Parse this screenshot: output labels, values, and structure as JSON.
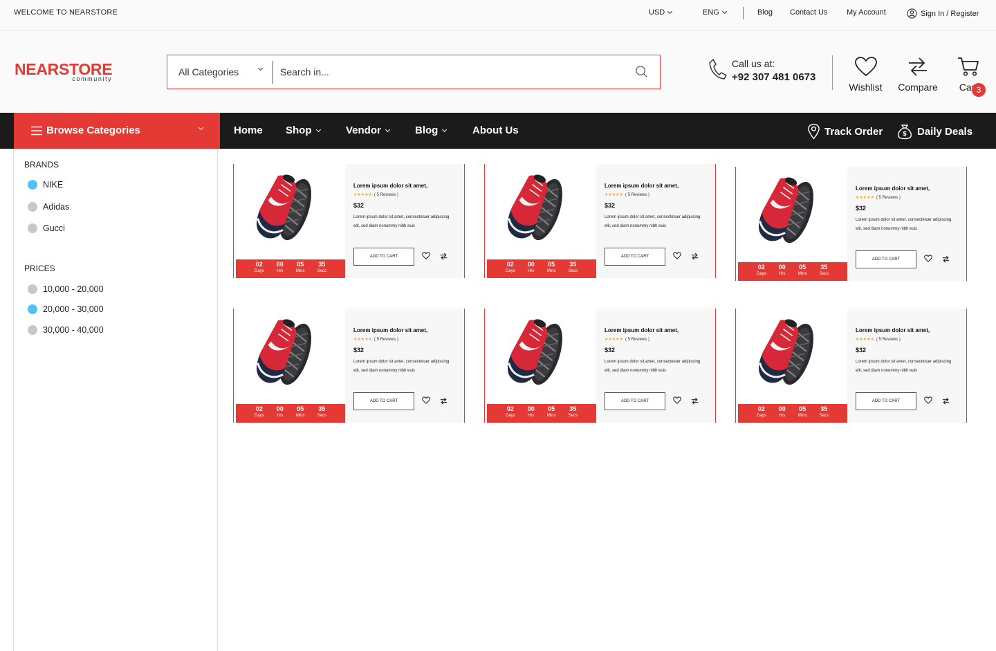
{
  "topbar": {
    "welcome": "WELCOME TO NEARSTORE",
    "currency": "USD",
    "language": "ENG",
    "links": [
      "Blog",
      "Contact Us",
      "My Account"
    ],
    "signin": "Sign In / Register"
  },
  "header": {
    "logo_main": "NEARSTORE",
    "logo_sub": "community",
    "search_category": "All Categories",
    "search_placeholder": "Search in...",
    "call_label": "Call us at:",
    "phone": "+92 307 481 0673",
    "wishlist": "Wishlist",
    "compare": "Compare",
    "cart": "Cart",
    "cart_count": "3"
  },
  "nav": {
    "browse": "Browse Categories",
    "items": [
      "Home",
      "Shop",
      "Vendor",
      "Blog",
      "About Us"
    ],
    "track": "Track Order",
    "deals": "Daily Deals"
  },
  "sidebar": {
    "brands_title": "BRANDS",
    "brands": [
      {
        "label": "NIKE",
        "selected": true
      },
      {
        "label": "Adidas",
        "selected": false
      },
      {
        "label": "Gucci",
        "selected": false
      }
    ],
    "prices_title": "PRICES",
    "prices": [
      {
        "label": "10,000 - 20,000",
        "selected": false
      },
      {
        "label": "20,000 - 30,000",
        "selected": true
      },
      {
        "label": "30,000 - 40,000",
        "selected": false
      }
    ]
  },
  "product": {
    "title": "Lorem ipsum dolor sit amet,",
    "stars": "★★★★★",
    "reviews": "( 5 Reviews )",
    "price": "$32",
    "desc": "Lorem ipsum dolor sit amet, consectetuer adipiscing elit, sed diam nonummy nibh euis",
    "add_to_cart": "ADD TO CART",
    "timer": [
      {
        "n": "02",
        "u": "Days"
      },
      {
        "n": "00",
        "u": "Hrs"
      },
      {
        "n": "05",
        "u": "Mins"
      },
      {
        "n": "35",
        "u": "Secs"
      }
    ]
  },
  "colors": {
    "accent": "#e53935",
    "nav_bg": "#1b1b1b",
    "radio_on": "#4fc3f7",
    "star": "#f5a623"
  }
}
